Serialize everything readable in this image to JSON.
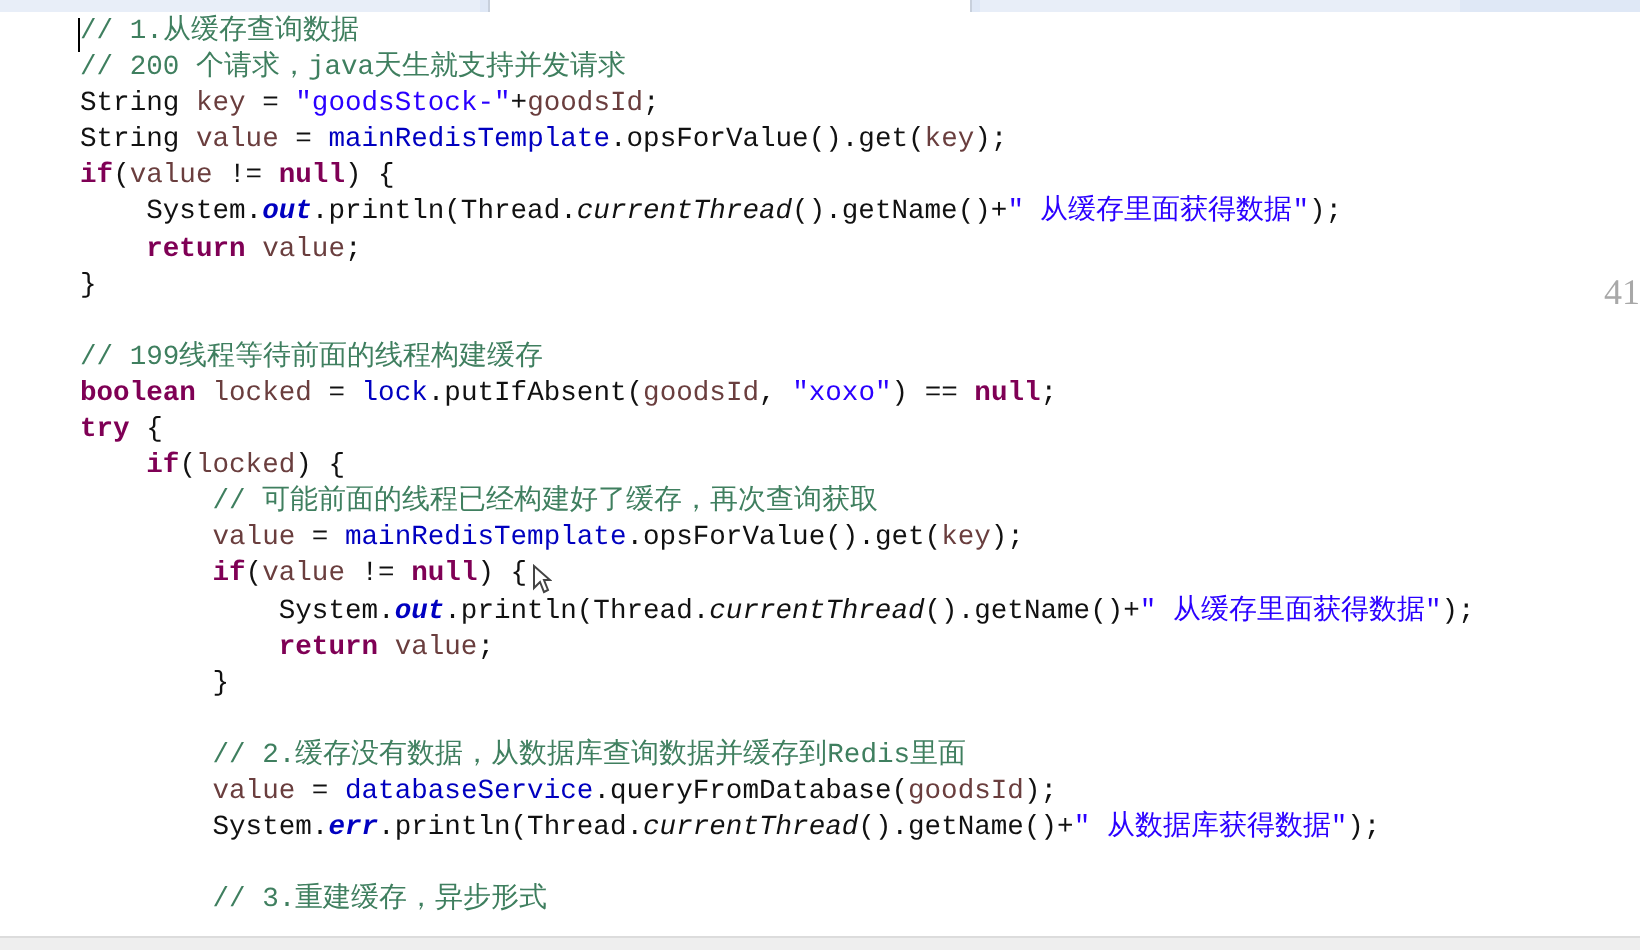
{
  "editor": {
    "tabs": [
      {
        "selected": false
      },
      {
        "selected": true
      },
      {
        "selected": false
      }
    ],
    "lines": [
      {
        "kind": "code",
        "tokens": [
          {
            "text": "// 1.从缓存查询数据",
            "kind": "comment"
          }
        ]
      },
      {
        "kind": "code",
        "tokens": [
          {
            "text": "// 200 个请求，java天生就支持并发请求",
            "kind": "comment"
          }
        ]
      },
      {
        "kind": "code",
        "tokens": [
          {
            "text": "String ",
            "kind": "plain"
          },
          {
            "text": "key",
            "kind": "local"
          },
          {
            "text": " = ",
            "kind": "plain"
          },
          {
            "text": "\"goodsStock-\"",
            "kind": "string"
          },
          {
            "text": "+",
            "kind": "plain"
          },
          {
            "text": "goodsId",
            "kind": "local"
          },
          {
            "text": ";",
            "kind": "plain"
          }
        ]
      },
      {
        "kind": "code",
        "tokens": [
          {
            "text": "String ",
            "kind": "plain"
          },
          {
            "text": "value",
            "kind": "local"
          },
          {
            "text": " = ",
            "kind": "plain"
          },
          {
            "text": "mainRedisTemplate",
            "kind": "member"
          },
          {
            "text": ".opsForValue().get(",
            "kind": "plain"
          },
          {
            "text": "key",
            "kind": "local"
          },
          {
            "text": ");",
            "kind": "plain"
          }
        ]
      },
      {
        "kind": "code",
        "tokens": [
          {
            "text": "if",
            "kind": "keyword"
          },
          {
            "text": "(",
            "kind": "plain"
          },
          {
            "text": "value",
            "kind": "local"
          },
          {
            "text": " != ",
            "kind": "plain"
          },
          {
            "text": "null",
            "kind": "keyword"
          },
          {
            "text": ") {",
            "kind": "plain"
          }
        ]
      },
      {
        "kind": "code",
        "tokens": [
          {
            "text": "    System.",
            "kind": "plain"
          },
          {
            "text": "out",
            "kind": "field"
          },
          {
            "text": ".println(Thread.",
            "kind": "plain"
          },
          {
            "text": "currentThread",
            "kind": "static"
          },
          {
            "text": "().getName()+",
            "kind": "plain"
          },
          {
            "text": "\" 从缓存里面获得数据\"",
            "kind": "string"
          },
          {
            "text": ");",
            "kind": "plain"
          }
        ]
      },
      {
        "kind": "code",
        "tokens": [
          {
            "text": "    return ",
            "kind": "keyword"
          },
          {
            "text": "value",
            "kind": "local"
          },
          {
            "text": ";",
            "kind": "plain"
          }
        ]
      },
      {
        "kind": "code",
        "tokens": [
          {
            "text": "}",
            "kind": "plain"
          }
        ]
      },
      {
        "kind": "blank"
      },
      {
        "kind": "code",
        "tokens": [
          {
            "text": "// 199线程等待前面的线程构建缓存",
            "kind": "comment"
          }
        ]
      },
      {
        "kind": "code",
        "tokens": [
          {
            "text": "boolean ",
            "kind": "keyword"
          },
          {
            "text": "locked",
            "kind": "local"
          },
          {
            "text": " = ",
            "kind": "plain"
          },
          {
            "text": "lock",
            "kind": "member"
          },
          {
            "text": ".putIfAbsent(",
            "kind": "plain"
          },
          {
            "text": "goodsId",
            "kind": "local"
          },
          {
            "text": ", ",
            "kind": "plain"
          },
          {
            "text": "\"xoxo\"",
            "kind": "string"
          },
          {
            "text": ") == ",
            "kind": "plain"
          },
          {
            "text": "null",
            "kind": "keyword"
          },
          {
            "text": ";",
            "kind": "plain"
          }
        ]
      },
      {
        "kind": "code",
        "tokens": [
          {
            "text": "try",
            "kind": "keyword"
          },
          {
            "text": " {",
            "kind": "plain"
          }
        ]
      },
      {
        "kind": "code",
        "tokens": [
          {
            "text": "    if",
            "kind": "keyword"
          },
          {
            "text": "(",
            "kind": "plain"
          },
          {
            "text": "locked",
            "kind": "local"
          },
          {
            "text": ") {",
            "kind": "plain"
          }
        ]
      },
      {
        "kind": "code",
        "tokens": [
          {
            "text": "        // 可能前面的线程已经构建好了缓存，再次查询获取",
            "kind": "comment"
          }
        ]
      },
      {
        "kind": "code",
        "tokens": [
          {
            "text": "        value",
            "kind": "local"
          },
          {
            "text": " = ",
            "kind": "plain"
          },
          {
            "text": "mainRedisTemplate",
            "kind": "member"
          },
          {
            "text": ".opsForValue().get(",
            "kind": "plain"
          },
          {
            "text": "key",
            "kind": "local"
          },
          {
            "text": ");",
            "kind": "plain"
          }
        ]
      },
      {
        "kind": "code",
        "tokens": [
          {
            "text": "        if",
            "kind": "keyword"
          },
          {
            "text": "(",
            "kind": "plain"
          },
          {
            "text": "value",
            "kind": "local"
          },
          {
            "text": " != ",
            "kind": "plain"
          },
          {
            "text": "null",
            "kind": "keyword"
          },
          {
            "text": ") {",
            "kind": "plain"
          }
        ]
      },
      {
        "kind": "code",
        "tokens": [
          {
            "text": "            System.",
            "kind": "plain"
          },
          {
            "text": "out",
            "kind": "field"
          },
          {
            "text": ".println(Thread.",
            "kind": "plain"
          },
          {
            "text": "currentThread",
            "kind": "static"
          },
          {
            "text": "().getName()+",
            "kind": "plain"
          },
          {
            "text": "\" 从缓存里面获得数据\"",
            "kind": "string"
          },
          {
            "text": ");",
            "kind": "plain"
          }
        ]
      },
      {
        "kind": "code",
        "tokens": [
          {
            "text": "            return ",
            "kind": "keyword"
          },
          {
            "text": "value",
            "kind": "local"
          },
          {
            "text": ";",
            "kind": "plain"
          }
        ]
      },
      {
        "kind": "code",
        "tokens": [
          {
            "text": "        }",
            "kind": "plain"
          }
        ]
      },
      {
        "kind": "blank"
      },
      {
        "kind": "code",
        "tokens": [
          {
            "text": "        // 2.缓存没有数据，从数据库查询数据并缓存到Redis里面",
            "kind": "comment"
          }
        ]
      },
      {
        "kind": "code",
        "tokens": [
          {
            "text": "        value",
            "kind": "local"
          },
          {
            "text": " = ",
            "kind": "plain"
          },
          {
            "text": "databaseService",
            "kind": "member"
          },
          {
            "text": ".queryFromDatabase(",
            "kind": "plain"
          },
          {
            "text": "goodsId",
            "kind": "local"
          },
          {
            "text": ");",
            "kind": "plain"
          }
        ]
      },
      {
        "kind": "code",
        "tokens": [
          {
            "text": "        System.",
            "kind": "plain"
          },
          {
            "text": "err",
            "kind": "field"
          },
          {
            "text": ".println(Thread.",
            "kind": "plain"
          },
          {
            "text": "currentThread",
            "kind": "static"
          },
          {
            "text": "().getName()+",
            "kind": "plain"
          },
          {
            "text": "\" 从数据库获得数据\"",
            "kind": "string"
          },
          {
            "text": ");",
            "kind": "plain"
          }
        ]
      },
      {
        "kind": "blank"
      },
      {
        "kind": "code",
        "tokens": [
          {
            "text": "        // 3.重建缓存，异步形式",
            "kind": "comment"
          }
        ]
      }
    ],
    "edge_text": "41"
  }
}
